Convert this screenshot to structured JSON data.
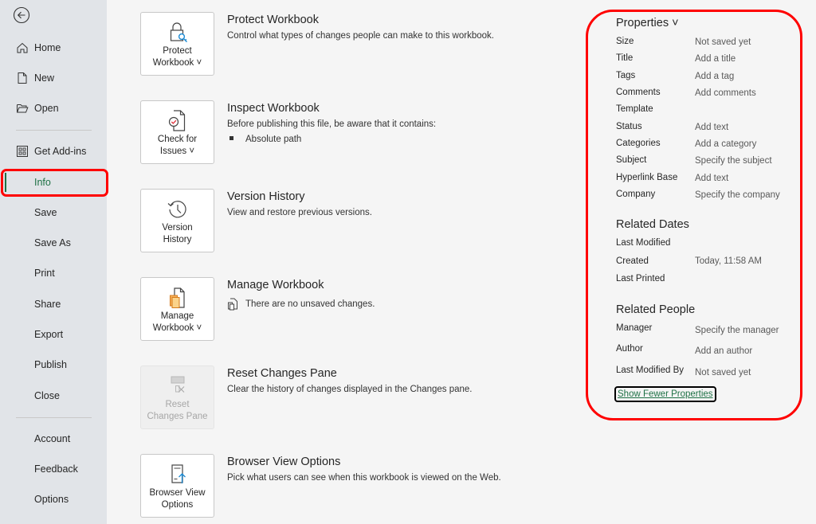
{
  "sidebar": {
    "back_label": "Back",
    "items": [
      {
        "label": "Home",
        "icon": "home-icon"
      },
      {
        "label": "New",
        "icon": "new-document-icon"
      },
      {
        "label": "Open",
        "icon": "folder-open-icon"
      },
      {
        "label": "Get Add-ins",
        "icon": "add-ins-grid-icon"
      },
      {
        "label": "Info",
        "active": true
      },
      {
        "label": "Save"
      },
      {
        "label": "Save As"
      },
      {
        "label": "Print"
      },
      {
        "label": "Share"
      },
      {
        "label": "Export"
      },
      {
        "label": "Publish"
      },
      {
        "label": "Close"
      },
      {
        "label": "Account"
      },
      {
        "label": "Feedback"
      },
      {
        "label": "Options"
      }
    ]
  },
  "actions": [
    {
      "button": "Protect\nWorkbook ˅",
      "title": "Protect Workbook",
      "desc": "Control what types of changes people can make to this workbook."
    },
    {
      "button": "Check for\nIssues ˅",
      "title": "Inspect Workbook",
      "desc": "Before publishing this file, be aware that it contains:",
      "bullets": [
        "Absolute path"
      ]
    },
    {
      "button": "Version\nHistory",
      "title": "Version History",
      "desc": "View and restore previous versions."
    },
    {
      "button": "Manage\nWorkbook ˅",
      "title": "Manage Workbook",
      "desc": "There are no unsaved changes."
    },
    {
      "button": "Reset\nChanges Pane",
      "title": "Reset Changes Pane",
      "desc": "Clear the history of changes displayed in the Changes pane.",
      "disabled": true
    },
    {
      "button": "Browser View\nOptions",
      "title": "Browser View Options",
      "desc": "Pick what users can see when this workbook is viewed on the Web."
    }
  ],
  "properties": {
    "heading": "Properties ˅",
    "rows": [
      {
        "key": "Size",
        "value": "Not saved yet"
      },
      {
        "key": "Title",
        "value": "Add a title"
      },
      {
        "key": "Tags",
        "value": "Add a tag"
      },
      {
        "key": "Comments",
        "value": "Add comments"
      },
      {
        "key": "Template",
        "value": ""
      },
      {
        "key": "Status",
        "value": "Add text"
      },
      {
        "key": "Categories",
        "value": "Add a category"
      },
      {
        "key": "Subject",
        "value": "Specify the subject"
      },
      {
        "key": "Hyperlink Base",
        "value": "Add text"
      },
      {
        "key": "Company",
        "value": "Specify the company"
      }
    ],
    "related_dates": {
      "heading": "Related Dates",
      "rows": [
        {
          "key": "Last Modified",
          "value": ""
        },
        {
          "key": "Created",
          "value": "Today, 11:58 AM"
        },
        {
          "key": "Last Printed",
          "value": ""
        }
      ]
    },
    "related_people": {
      "heading": "Related People",
      "rows": [
        {
          "key": "Manager",
          "value": "Specify the manager"
        },
        {
          "key": "Author",
          "value": "Add an author"
        },
        {
          "key": "Last Modified By",
          "value": "Not saved yet"
        }
      ]
    },
    "show_fewer_label": "Show Fewer Properties"
  },
  "colors": {
    "accent": "#1e7145",
    "annotation": "#ff0000",
    "sidebar_bg": "#e1e4e8",
    "main_bg": "#f5f5f5"
  }
}
